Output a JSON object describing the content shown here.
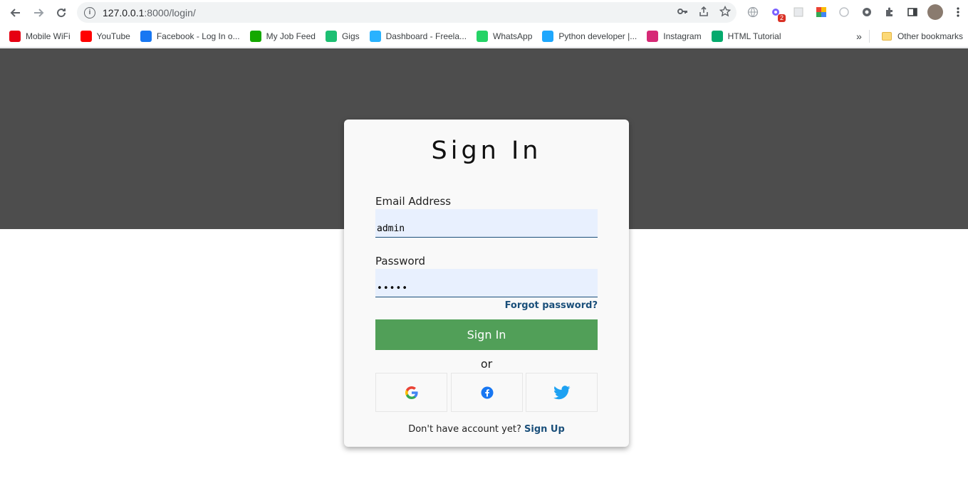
{
  "browser": {
    "url_host": "127.0.0.1",
    "url_path": ":8000/login/",
    "extension_badge": "2",
    "bookmarks": [
      {
        "label": "Mobile WiFi",
        "icon": "huawei-icon",
        "color": "#e60012"
      },
      {
        "label": "YouTube",
        "icon": "youtube-icon",
        "color": "#ff0000"
      },
      {
        "label": "Facebook - Log In o...",
        "icon": "facebook-icon",
        "color": "#1877f2"
      },
      {
        "label": "My Job Feed",
        "icon": "upwork-icon",
        "color": "#14a800"
      },
      {
        "label": "Gigs",
        "icon": "fiverr-icon",
        "color": "#1dbf73"
      },
      {
        "label": "Dashboard - Freela...",
        "icon": "freelancer-icon",
        "color": "#29b2fe"
      },
      {
        "label": "WhatsApp",
        "icon": "whatsapp-icon",
        "color": "#25d366"
      },
      {
        "label": "Python developer |...",
        "icon": "bird-icon",
        "color": "#1ea7fd"
      },
      {
        "label": "Instagram",
        "icon": "instagram-icon",
        "color": "#d62976"
      },
      {
        "label": "HTML Tutorial",
        "icon": "w3schools-icon",
        "color": "#04aa6d"
      }
    ],
    "more_bookmarks": "»",
    "other_bookmarks": "Other bookmarks"
  },
  "login": {
    "title": "Sign In",
    "email_label": "Email Address",
    "email_value": "admin",
    "password_label": "Password",
    "password_value": "•••••",
    "forgot_link": "Forgot password?",
    "submit_label": "Sign In",
    "or_text": "or",
    "footer_text": "Don't have account yet?",
    "signup_link": "Sign Up"
  },
  "colors": {
    "hero_bg": "#4d4d4d",
    "accent": "#1a4f7a",
    "button": "#519f58"
  }
}
